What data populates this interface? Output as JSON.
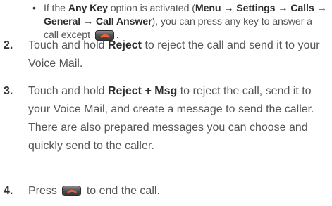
{
  "bullet": {
    "t1": "If the ",
    "any_key": "Any Key",
    "t2": " option is activated (",
    "menu": "Menu",
    "settings": "Settings",
    "calls": "Calls",
    "general": "General",
    "call_answer": "Call Answer",
    "t3": "), you can press any key to answer a call except",
    "t4": ".",
    "arrow": " → "
  },
  "steps": [
    {
      "number": "2.",
      "t1": "Touch and hold ",
      "bold1": "Reject",
      "t2": " to reject the call and send it to your",
      "line2": "Voice Mail."
    },
    {
      "number": "3.",
      "t1": "Touch and hold ",
      "bold1": "Reject + Msg",
      "t2": " to reject the call, send it to",
      "line2": "your Voice Mail, and create a message to send the caller.",
      "line3": "There are also prepared messages you can choose and",
      "line4": "quickly send to the caller."
    },
    {
      "number": "4.",
      "t1": "Press",
      "t2": "to end the call."
    }
  ],
  "icons": {
    "end_key": "end-call-key-icon",
    "bullet": "bullet-dot"
  }
}
